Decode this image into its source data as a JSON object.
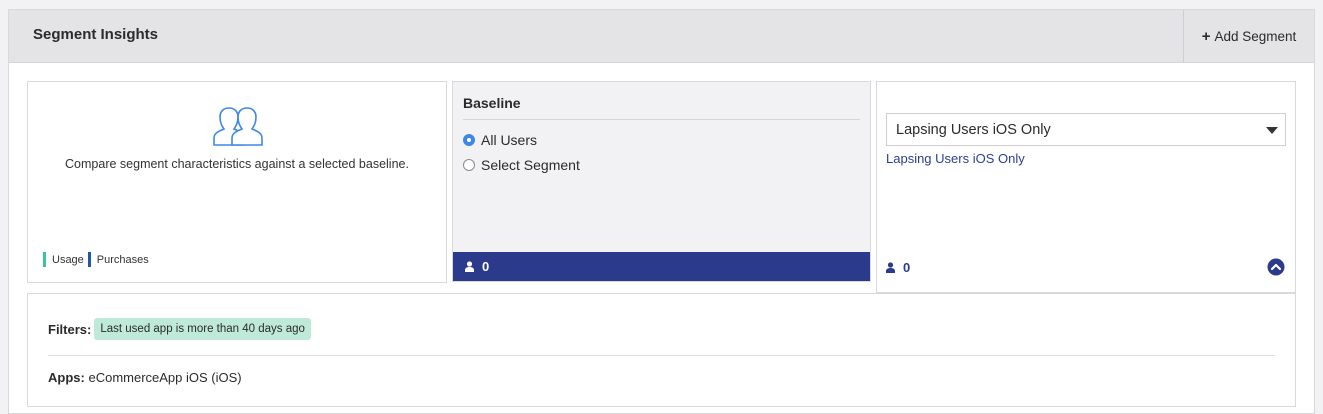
{
  "header": {
    "title": "Segment Insights",
    "add_segment_label": "Add Segment",
    "add_icon": "plus-icon"
  },
  "info_card": {
    "icon": "users-icon",
    "text": "Compare segment characteristics against a selected baseline.",
    "legend": [
      {
        "label": "Usage",
        "color": "#3fc39a"
      },
      {
        "label": "Purchases",
        "color": "#2456a6"
      }
    ]
  },
  "baseline": {
    "title": "Baseline",
    "options": [
      {
        "label": "All Users",
        "selected": true
      },
      {
        "label": "Select Segment",
        "selected": false
      }
    ],
    "count": "0",
    "count_icon": "person-icon",
    "footer_color": "#2c3a8c"
  },
  "segment": {
    "selected": "Lapsing Users iOS Only",
    "link_text": "Lapsing Users iOS Only",
    "count": "0",
    "count_icon": "person-icon",
    "collapse_icon": "chevron-up-circle-icon"
  },
  "details": {
    "filters_label": "Filters:",
    "filter_chip": "Last used app is more than 40 days ago",
    "apps_label": "Apps:",
    "apps_value": "eCommerceApp iOS (iOS)"
  },
  "colors": {
    "accent_blue": "#2c3a8c",
    "radio_blue": "#3e87e8",
    "chip_green": "#bfe9d9"
  }
}
